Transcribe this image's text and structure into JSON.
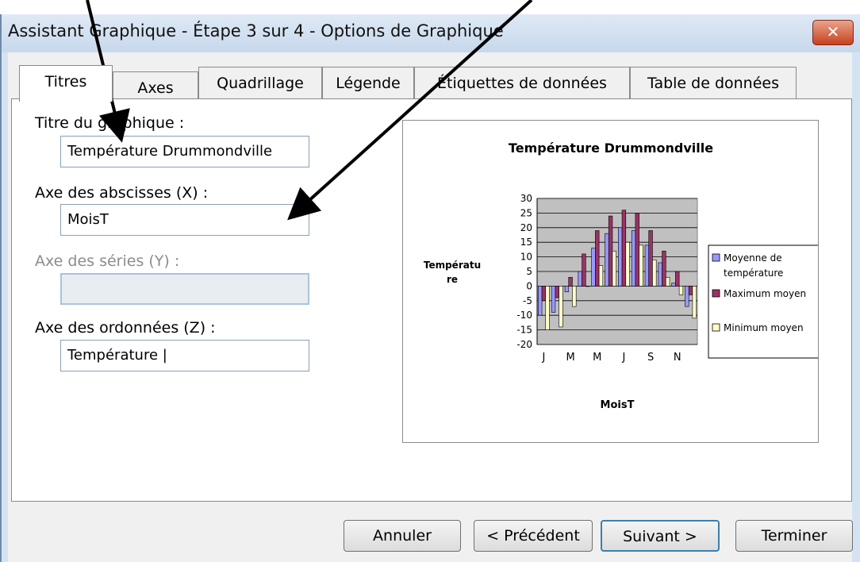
{
  "window": {
    "title": "Assistant Graphique - Étape 3 sur 4 - Options de Graphique",
    "close_label": "✕"
  },
  "tabs": [
    "Titres",
    "Axes",
    "Quadrillage",
    "Légende",
    "Étiquettes de données",
    "Table de données"
  ],
  "fields": {
    "chart_title": {
      "label": "Titre du graphique :",
      "value": "Température Drummondville"
    },
    "x_axis": {
      "label": "Axe des abscisses (X) :",
      "value": "MoisT"
    },
    "y_series": {
      "label": "Axe des séries (Y) :",
      "value": ""
    },
    "z_axis": {
      "label": "Axe des ordonnées (Z) :",
      "value": "Température |"
    }
  },
  "buttons": {
    "cancel": "Annuler",
    "prev": "< Précédent",
    "next": "Suivant >",
    "finish": "Terminer"
  },
  "chart_data": {
    "type": "bar",
    "title": "Température Drummondville",
    "xlabel": "MoisT",
    "ylabel_line1": "Températu",
    "ylabel_line2": "re",
    "ylim": [
      -20,
      30
    ],
    "yticks": [
      "30",
      "25",
      "20",
      "15",
      "10",
      "5",
      "0",
      "-5",
      "-10",
      "-15",
      "-20"
    ],
    "xticklabels": [
      "J",
      "M",
      "M",
      "J",
      "S",
      "N"
    ],
    "categories": [
      "1",
      "2",
      "3",
      "4",
      "5",
      "6",
      "7",
      "8",
      "9",
      "10",
      "11",
      "12"
    ],
    "series": [
      {
        "name": "Moyenne de température",
        "values": [
          -10,
          -9,
          -2,
          5,
          13,
          18,
          20,
          19,
          14,
          8,
          1,
          -7
        ]
      },
      {
        "name": "Maximum moyen",
        "values": [
          -5,
          -4,
          3,
          11,
          19,
          24,
          26,
          25,
          19,
          12,
          5,
          -3
        ]
      },
      {
        "name": "Minimum moyen",
        "values": [
          -15,
          -14,
          -7,
          0,
          7,
          12,
          15,
          14,
          9,
          3,
          -3,
          -11
        ]
      }
    ],
    "legend": [
      "Moyenne de",
      "température",
      "Maximum moyen",
      "Minimum moyen"
    ],
    "colors": [
      "#9999ff",
      "#993366",
      "#ffffcc"
    ],
    "plot_bg": "#c0c0c0",
    "grid": true,
    "legend_position": "right"
  }
}
